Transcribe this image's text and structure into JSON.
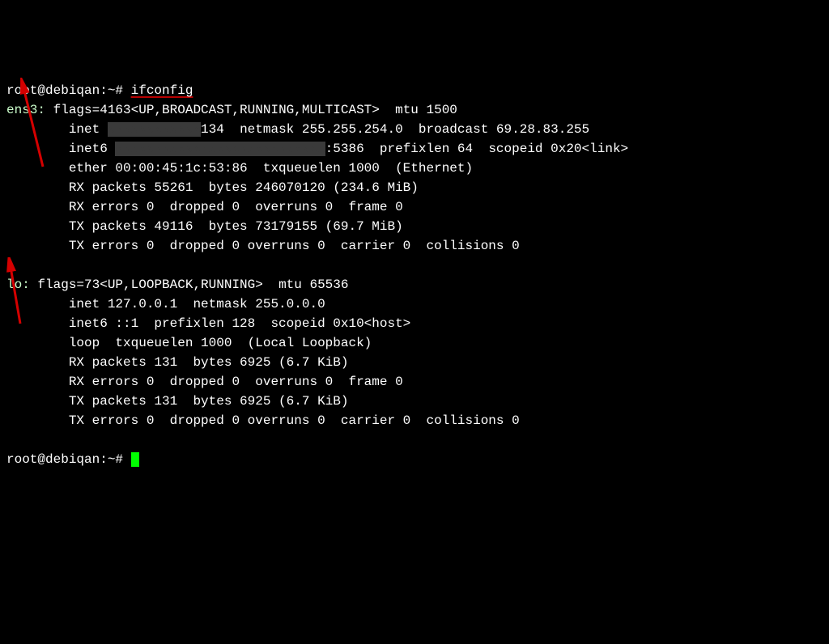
{
  "prompt1": "root@debiqan:~# ",
  "command": "ifconfig",
  "ens3": {
    "name": "ens3:",
    "flags": " flags=4163<UP,BROADCAST,RUNNING,MULTICAST>  mtu 1500",
    "inet_label": "        inet ",
    "inet_ip_end": "134",
    "inet_rest": "  netmask 255.255.254.0  broadcast 69.28.83.255",
    "inet6_label": "        inet6 ",
    "inet6_end": ":5386",
    "inet6_rest": "  prefixlen 64  scopeid 0x20<link>",
    "ether": "        ether 00:00:45:1c:53:86  txqueuelen 1000  (Ethernet)",
    "rxp": "        RX packets 55261  bytes 246070120 (234.6 MiB)",
    "rxe": "        RX errors 0  dropped 0  overruns 0  frame 0",
    "txp": "        TX packets 49116  bytes 73179155 (69.7 MiB)",
    "txe": "        TX errors 0  dropped 0 overruns 0  carrier 0  collisions 0"
  },
  "lo": {
    "name": "lo:",
    "flags": " flags=73<UP,LOOPBACK,RUNNING>  mtu 65536",
    "inet": "        inet 127.0.0.1  netmask 255.0.0.0",
    "inet6": "        inet6 ::1  prefixlen 128  scopeid 0x10<host>",
    "loop": "        loop  txqueuelen 1000  (Local Loopback)",
    "rxp": "        RX packets 131  bytes 6925 (6.7 KiB)",
    "rxe": "        RX errors 0  dropped 0  overruns 0  frame 0",
    "txp": "        TX packets 131  bytes 6925 (6.7 KiB)",
    "txe": "        TX errors 0  dropped 0 overruns 0  carrier 0  collisions 0"
  },
  "prompt2": "root@debiqan:~# ",
  "redacted_v4": "xxxxxxxxxxxx",
  "redacted_v6": "xxxxxxxxxxxxxxxxxxxxxxxxxxx"
}
